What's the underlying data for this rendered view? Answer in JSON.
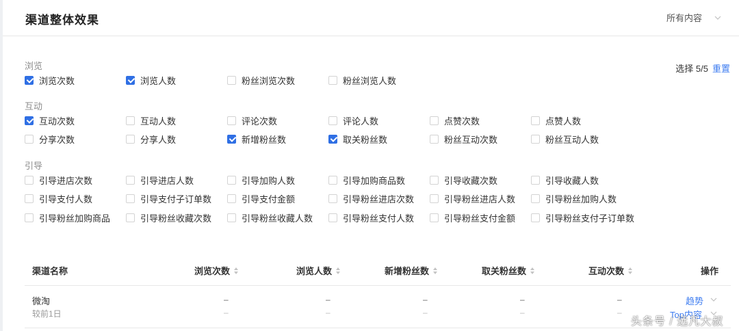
{
  "header": {
    "title": "渠道整体效果",
    "filter_label": "所有内容"
  },
  "selection": {
    "text": "选择 5/5",
    "reset_label": "重置"
  },
  "groups": [
    {
      "title": "浏览",
      "items": [
        {
          "label": "浏览次数",
          "checked": true
        },
        {
          "label": "浏览人数",
          "checked": true
        },
        {
          "label": "粉丝浏览次数",
          "checked": false
        },
        {
          "label": "粉丝浏览人数",
          "checked": false
        }
      ]
    },
    {
      "title": "互动",
      "items": [
        {
          "label": "互动次数",
          "checked": true
        },
        {
          "label": "互动人数",
          "checked": false
        },
        {
          "label": "评论次数",
          "checked": false
        },
        {
          "label": "评论人数",
          "checked": false
        },
        {
          "label": "点赞次数",
          "checked": false
        },
        {
          "label": "点赞人数",
          "checked": false
        },
        {
          "label": "分享次数",
          "checked": false
        },
        {
          "label": "分享人数",
          "checked": false
        },
        {
          "label": "新增粉丝数",
          "checked": true
        },
        {
          "label": "取关粉丝数",
          "checked": true
        },
        {
          "label": "粉丝互动次数",
          "checked": false
        },
        {
          "label": "粉丝互动人数",
          "checked": false
        }
      ]
    },
    {
      "title": "引导",
      "items": [
        {
          "label": "引导进店次数",
          "checked": false
        },
        {
          "label": "引导进店人数",
          "checked": false
        },
        {
          "label": "引导加购人数",
          "checked": false
        },
        {
          "label": "引导加购商品数",
          "checked": false
        },
        {
          "label": "引导收藏次数",
          "checked": false
        },
        {
          "label": "引导收藏人数",
          "checked": false
        },
        {
          "label": "引导支付人数",
          "checked": false
        },
        {
          "label": "引导支付子订单数",
          "checked": false
        },
        {
          "label": "引导支付金额",
          "checked": false
        },
        {
          "label": "引导粉丝进店次数",
          "checked": false
        },
        {
          "label": "引导粉丝进店人数",
          "checked": false
        },
        {
          "label": "引导粉丝加购人数",
          "checked": false
        },
        {
          "label": "引导粉丝加购商品",
          "checked": false
        },
        {
          "label": "引导粉丝收藏次数",
          "checked": false
        },
        {
          "label": "引导粉丝收藏人数",
          "checked": false
        },
        {
          "label": "引导粉丝支付人数",
          "checked": false
        },
        {
          "label": "引导粉丝支付金额",
          "checked": false
        },
        {
          "label": "引导粉丝支付子订单数",
          "checked": false
        }
      ]
    }
  ],
  "table": {
    "columns": [
      "渠道名称",
      "浏览次数",
      "浏览人数",
      "新增粉丝数",
      "取关粉丝数",
      "互动次数",
      "操作"
    ],
    "rows": [
      {
        "name": "微淘",
        "sub": "较前1日",
        "values": [
          "–",
          "–",
          "–",
          "–",
          "–"
        ],
        "sub_values": [
          "–",
          "–",
          "–",
          "–",
          "–"
        ],
        "actions": [
          "趋势",
          "Top内容"
        ]
      }
    ]
  },
  "watermark": "头条号 / 远凡大叔",
  "colors": {
    "accent": "#3d7cf0",
    "checkbox_checked": "#2f6fe4",
    "group_title": "#8c8c8c"
  }
}
